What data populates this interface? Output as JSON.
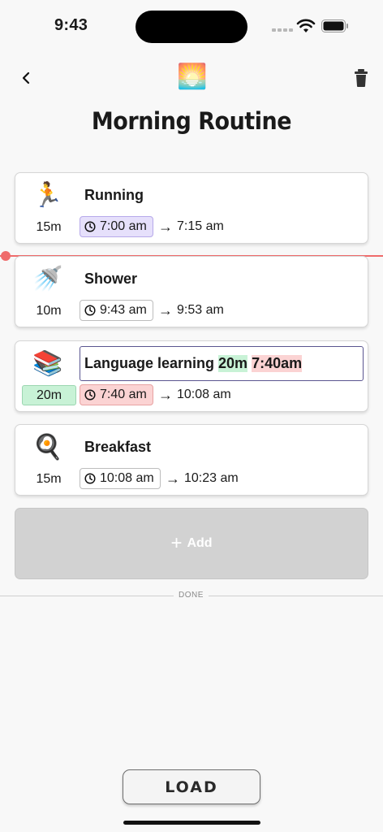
{
  "status_bar": {
    "time": "9:43"
  },
  "header": {
    "emoji": "🌅",
    "title": "Morning Routine"
  },
  "tasks": [
    {
      "emoji": "🏃",
      "name": "Running",
      "duration": "15m",
      "start": "7:00 am",
      "end": "7:15 am"
    },
    {
      "emoji": "🚿",
      "name": "Shower",
      "duration": "10m",
      "start": "9:43 am",
      "end": "9:53 am"
    },
    {
      "emoji": "📚",
      "name": "Language learning",
      "name_duration": "20m",
      "name_time": "7:40am",
      "duration": "20m",
      "start": "7:40 am",
      "end": "10:08 am"
    },
    {
      "emoji": "🍳",
      "name": "Breakfast",
      "duration": "15m",
      "start": "10:08 am",
      "end": "10:23 am"
    }
  ],
  "add_button": {
    "label": "Add"
  },
  "done_label": "DONE",
  "load_button": {
    "label": "LOAD"
  },
  "colors": {
    "now_line": "#ef6b6b",
    "highlight_green": "#c8f2d6",
    "highlight_red": "#fbd3d3",
    "highlight_purple": "#e6e0fb"
  }
}
